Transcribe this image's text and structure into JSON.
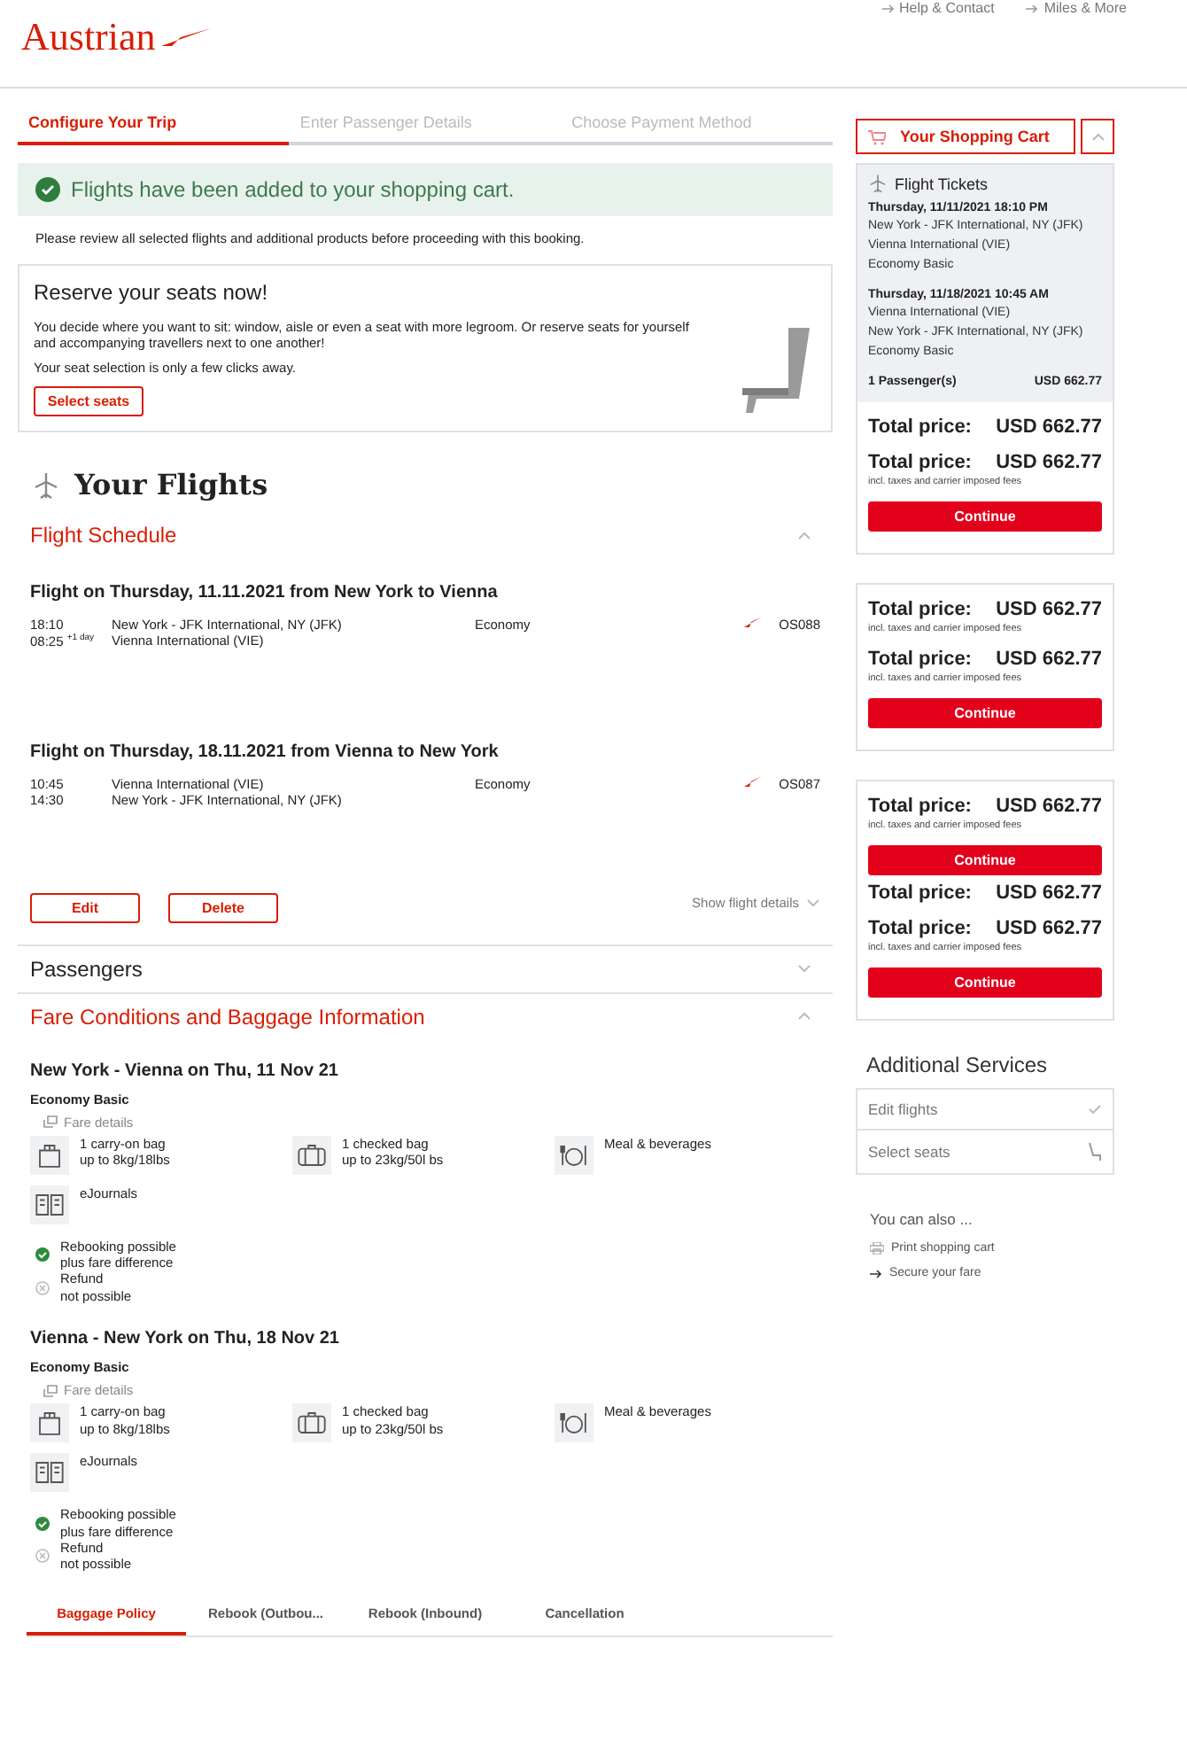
{
  "header": {
    "logo": "Austrian",
    "links": [
      "Help & Contact",
      "Miles & More"
    ]
  },
  "steps": [
    {
      "label": "Configure Your Trip",
      "selected": true
    },
    {
      "label": "Enter Passenger Details",
      "selected": false
    },
    {
      "label": "Choose Payment Method",
      "selected": false
    }
  ],
  "notice": "Flights have been added to your shopping cart.",
  "intro": "Please review all selected flights and additional products before proceeding with this booking.",
  "seat_promo": {
    "title": "Reserve your seats now!",
    "text": "You decide where you want to sit: window, aisle or even a seat with more legroom. Or reserve seats for yourself and accompanying travellers next to one another!",
    "note": "Your seat selection is only a few clicks away.",
    "button": "Select seats"
  },
  "flights_heading": "Your Flights",
  "schedule": {
    "title": "Flight Schedule",
    "expanded": true,
    "flights": [
      {
        "heading": "Flight on Thursday, 11.11.2021 from New York to Vienna",
        "cabin": "Economy",
        "number": "OS088",
        "stops": [
          {
            "time": "18:10",
            "airport": "New York - JFK International, NY (JFK)"
          },
          {
            "time": "08:25",
            "extra": "+1 day",
            "airport": "Vienna International (VIE)"
          }
        ]
      },
      {
        "heading": "Flight on Thursday, 18.11.2021 from Vienna to New York",
        "cabin": "Economy",
        "number": "OS087",
        "stops": [
          {
            "time": "10:45",
            "airport": "Vienna International (VIE)"
          },
          {
            "time": "14:30",
            "airport": "New York - JFK International, NY (JFK)"
          }
        ]
      }
    ],
    "buttons": [
      "Edit",
      "Delete"
    ],
    "details_link": "Show flight details"
  },
  "passengers": {
    "title": "Passengers",
    "expanded": false
  },
  "fares": {
    "title": "Fare Conditions and Baggage Information",
    "expanded": true,
    "legs": [
      {
        "heading": "New York - Vienna on Thu, 11 Nov 21",
        "cabin": "Economy Basic",
        "details_link": "Fare details",
        "features": [
          {
            "kind": "carry-on",
            "lines": [
              "1 carry-on bag",
              "up to 8kg/18lbs"
            ]
          },
          {
            "kind": "checked",
            "lines": [
              "1 checked bag",
              "up to 23kg/50l bs"
            ]
          },
          {
            "kind": "meal",
            "lines": [
              "Meal & beverages"
            ]
          },
          {
            "kind": "journal",
            "lines": [
              "eJournals"
            ]
          }
        ],
        "conditions": [
          {
            "allowed": true,
            "lines": [
              "Rebooking possible",
              "plus fare difference"
            ]
          },
          {
            "allowed": false,
            "lines": [
              "Refund",
              "not possible"
            ]
          }
        ]
      },
      {
        "heading": "Vienna - New York on Thu, 18 Nov 21",
        "cabin": "Economy Basic",
        "details_link": "Fare details",
        "features": [
          {
            "kind": "carry-on",
            "lines": [
              "1 carry-on bag",
              "up to 8kg/18lbs"
            ]
          },
          {
            "kind": "checked",
            "lines": [
              "1 checked bag",
              "up to 23kg/50l bs"
            ]
          },
          {
            "kind": "meal",
            "lines": [
              "Meal & beverages"
            ]
          },
          {
            "kind": "journal",
            "lines": [
              "eJournals"
            ]
          }
        ],
        "conditions": [
          {
            "allowed": true,
            "lines": [
              "Rebooking possible",
              "plus fare difference"
            ]
          },
          {
            "allowed": false,
            "lines": [
              "Refund",
              "not possible"
            ]
          }
        ]
      }
    ],
    "tabs": [
      {
        "label": "Baggage Policy",
        "selected": true
      },
      {
        "label": "Rebook (Outbou...",
        "selected": false
      },
      {
        "label": "Rebook (Inbound)",
        "selected": false
      },
      {
        "label": "Cancellation",
        "selected": false
      }
    ]
  },
  "cart": {
    "title": "Your Shopping Cart",
    "expanded": true,
    "cards": [
      {
        "tickets": {
          "title": "Flight Tickets",
          "trips": [
            {
              "date": "Thursday, 11/11/2021 18:10 PM",
              "lines": [
                "New York - JFK International, NY (JFK)",
                "Vienna International (VIE)",
                "Economy Basic"
              ]
            },
            {
              "date": "Thursday, 11/18/2021 10:45 AM",
              "lines": [
                "Vienna International (VIE)",
                "New York - JFK International, NY (JFK)",
                "Economy Basic"
              ]
            }
          ],
          "passengers": "1 Passenger(s)",
          "subtotal": "USD 662.77"
        },
        "blocks": [
          {
            "kind": "price",
            "label": "Total price:",
            "amount": "USD 662.77"
          },
          {
            "kind": "price",
            "label": "Total price:",
            "amount": "USD 662.77",
            "note": "incl. taxes and carrier imposed fees"
          },
          {
            "kind": "button",
            "label": "Continue"
          }
        ]
      },
      {
        "blocks": [
          {
            "kind": "price",
            "label": "Total price:",
            "amount": "USD 662.77",
            "note": "incl. taxes and carrier imposed fees"
          },
          {
            "kind": "price",
            "label": "Total price:",
            "amount": "USD 662.77",
            "note": "incl. taxes and carrier imposed fees"
          },
          {
            "kind": "button",
            "label": "Continue"
          }
        ]
      },
      {
        "blocks": [
          {
            "kind": "price",
            "label": "Total price:",
            "amount": "USD 662.77",
            "note": "incl. taxes and carrier imposed fees"
          },
          {
            "kind": "button",
            "label": "Continue"
          },
          {
            "kind": "price",
            "label": "Total price:",
            "amount": "USD 662.77"
          },
          {
            "kind": "price",
            "label": "Total price:",
            "amount": "USD 662.77",
            "note": "incl. taxes and carrier imposed fees"
          },
          {
            "kind": "button",
            "label": "Continue"
          }
        ]
      }
    ]
  },
  "services": {
    "title": "Additional Services",
    "items": [
      {
        "label": "Edit flights",
        "kind": "check"
      },
      {
        "label": "Select seats",
        "kind": "seat"
      }
    ]
  },
  "also": {
    "title": "You can also ...",
    "links": [
      {
        "label": "Print shopping cart",
        "kind": "print"
      },
      {
        "label": "Secure your fare",
        "kind": "arrow"
      }
    ]
  }
}
